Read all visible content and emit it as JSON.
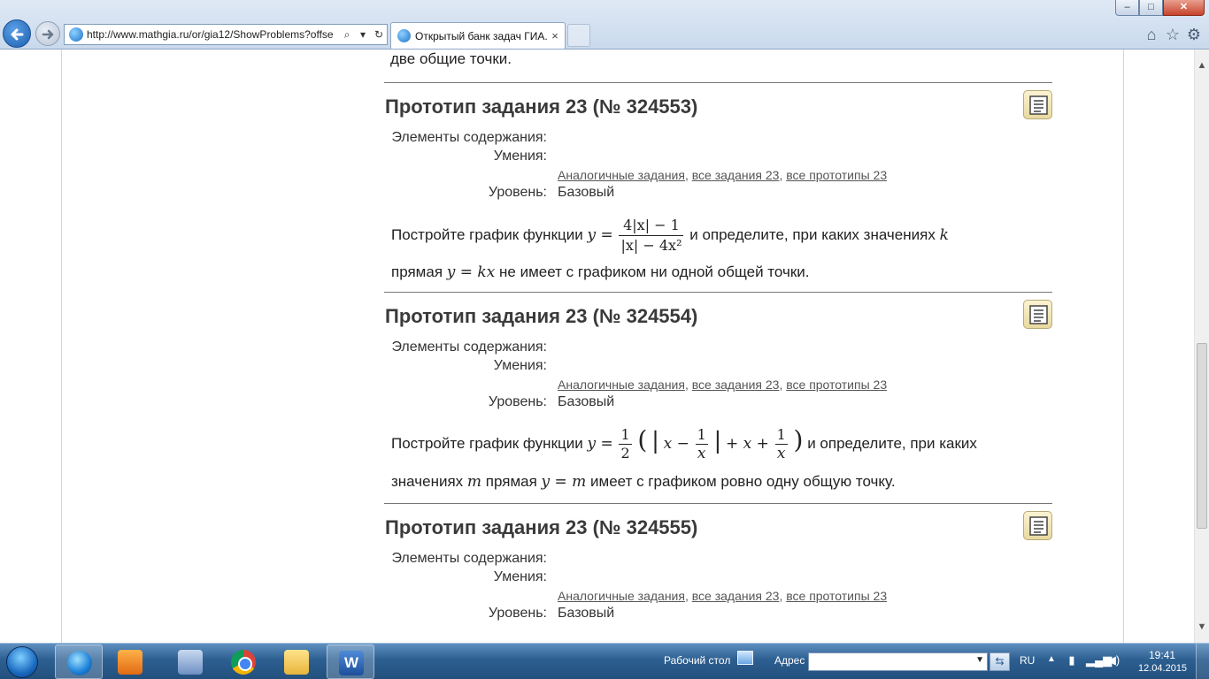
{
  "browser": {
    "url": "http://www.mathgia.ru/or/gia12/ShowProblems?offse",
    "tab_title": "Открытый банк задач ГИА...",
    "tab_close": "×",
    "addr_search": "⌕",
    "addr_dropdown": "▾",
    "addr_refresh": "↻",
    "min": "–",
    "max": "□",
    "close": "✕",
    "home": "⌂",
    "star": "☆",
    "tools": "⚙"
  },
  "page": {
    "prev_tail": "две общие точки.",
    "labels": {
      "elements": "Элементы содержания:",
      "skills": "Умения:",
      "level": "Уровень:"
    },
    "links": {
      "similar": "Аналогичные задания",
      "all_tasks": "все задания 23",
      "all_prototypes": "все прототипы 23",
      "sep": ", "
    },
    "problems": [
      {
        "title": "Прототип задания 23 (№ 324553)",
        "level": "Базовый",
        "text_a": "Постройте график функции",
        "y_eq": "y =",
        "frac_num": "4|x| − 1",
        "frac_den": "|x| − 4x²",
        "text_b": "и определите, при каких значениях",
        "var": "k",
        "text_c": "прямая",
        "line_eq": "y = kx",
        "text_d": "не имеет с графиком ни одной общей точки."
      },
      {
        "title": "Прототип задания 23 (№ 324554)",
        "level": "Базовый",
        "text_a": "Постройте график функции",
        "y_eq": "y =",
        "half_num": "1",
        "half_den": "2",
        "paren_open": "(",
        "abs_open": "|",
        "x1": "x −",
        "inner_num": "1",
        "inner_den": "x",
        "abs_close": "|",
        "plus_part": "+ x +",
        "tail_num": "1",
        "tail_den": "x",
        "paren_close": ")",
        "text_b": "и определите, при каких",
        "text_c": "значениях",
        "var": "m",
        "text_d": "прямая",
        "line_eq": "y = m",
        "text_e": "имеет с графиком ровно одну общую точку."
      },
      {
        "title": "Прототип задания 23 (№ 324555)",
        "level": "Базовый"
      }
    ]
  },
  "taskbar": {
    "desktop_label": "Рабочий стол",
    "address_label": "Адрес",
    "address_value": "",
    "address_arrow": "▼",
    "go_icon": "⇆",
    "lang": "RU",
    "tray_arrow": "▲",
    "tray_usb": "▮",
    "tray_net": "▂▄▆",
    "tray_vol": "◀)",
    "time": "19:41",
    "date": "12.04.2015",
    "word_letter": "W"
  },
  "icons": {
    "back": "back-arrow-icon",
    "forward": "forward-arrow-icon",
    "problem_doc": "document-icon"
  },
  "colors": {
    "title": "#3a3a3a",
    "link": "#555555",
    "taskbar": "#2d5f91"
  }
}
